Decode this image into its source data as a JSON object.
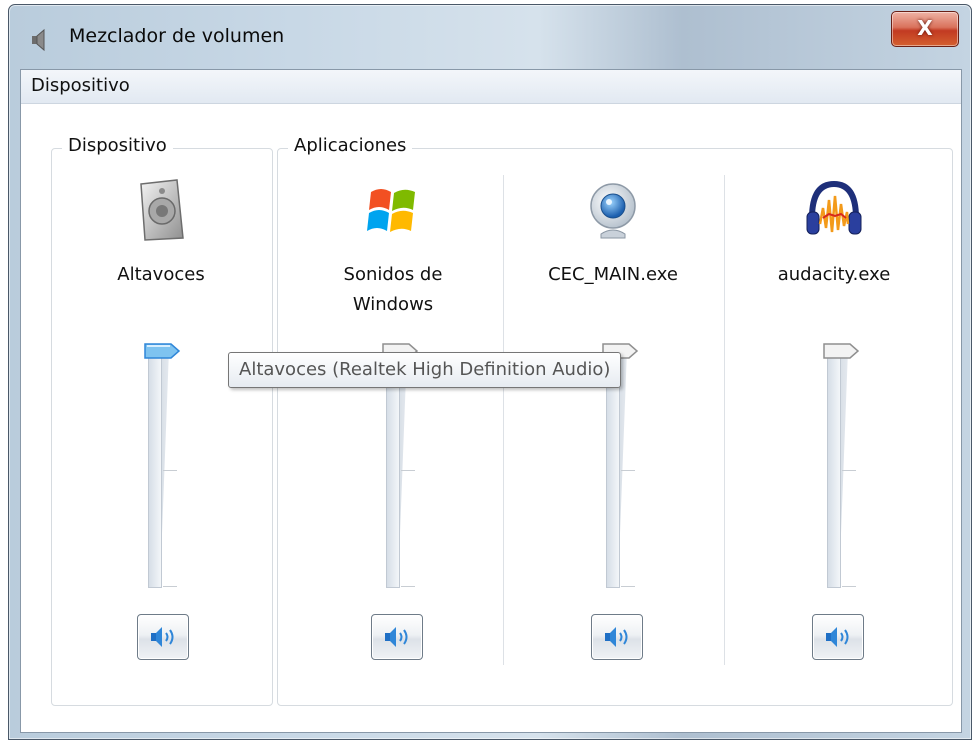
{
  "window": {
    "title": "Mezclador de volumen",
    "close_label": "X"
  },
  "menu": {
    "items": [
      "Dispositivo"
    ]
  },
  "device_group": {
    "label": "Dispositivo",
    "device": {
      "name": "Altavoces",
      "icon": "speaker-icon",
      "volume_percent": 100
    }
  },
  "apps_group": {
    "label": "Aplicaciones",
    "apps": [
      {
        "name": "Sonidos de Windows",
        "icon": "windows-logo-icon",
        "volume_percent": 100
      },
      {
        "name": "CEC_MAIN.exe",
        "icon": "webcam-icon",
        "volume_percent": 100
      },
      {
        "name": "audacity.exe",
        "icon": "audacity-icon",
        "volume_percent": 100
      }
    ]
  },
  "tooltip": {
    "text": "Altavoces (Realtek High Definition Audio)"
  },
  "colors": {
    "accent": "#2f86d8",
    "close": "#c23a22"
  }
}
